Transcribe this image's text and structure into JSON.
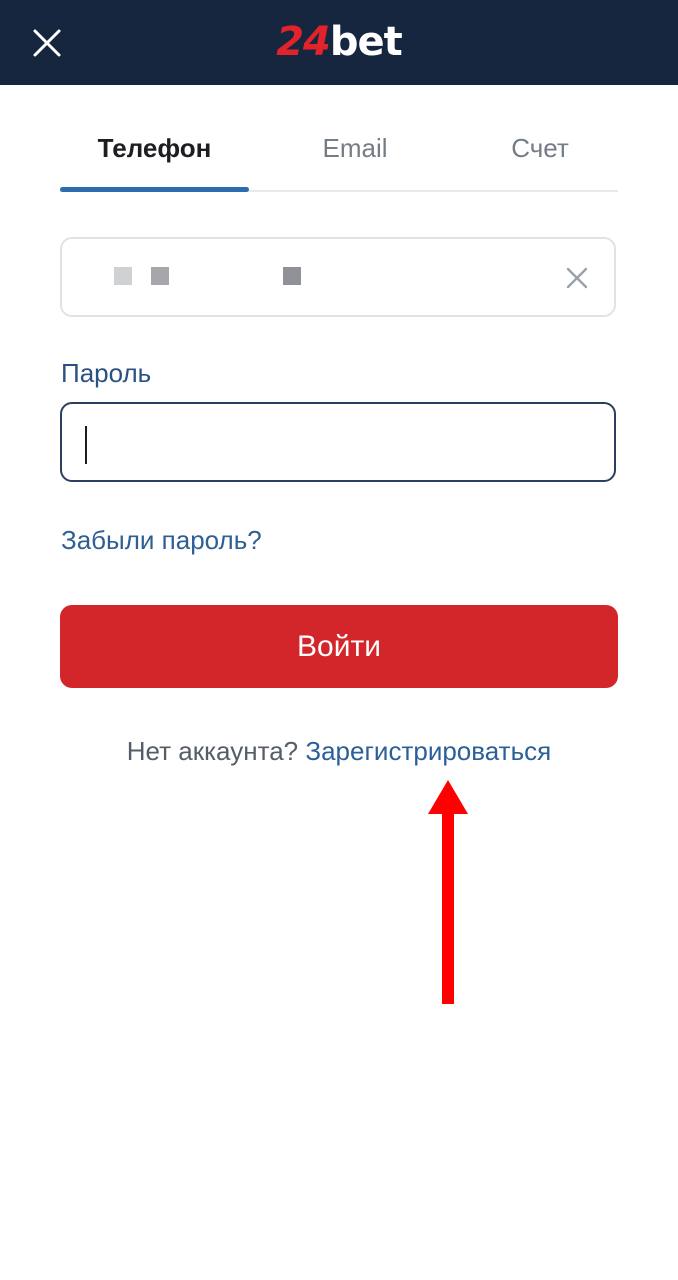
{
  "header": {
    "logo_number": "24",
    "logo_word": "bet",
    "close_icon": "close-icon"
  },
  "tabs": [
    {
      "label": "Телефон",
      "active": true
    },
    {
      "label": "Email",
      "active": false
    },
    {
      "label": "Счет",
      "active": false
    }
  ],
  "phone_input": {
    "value": "",
    "masked_squares": 3,
    "clear_icon": "clear-x-icon"
  },
  "password": {
    "label": "Пароль",
    "value": ""
  },
  "forgot_link": "Забыли пароль?",
  "login_button": "Войти",
  "signup": {
    "question": "Нет аккаунта?",
    "link": "Зарегистрироваться"
  },
  "colors": {
    "header_bg": "#17263f",
    "brand_red": "#d3262a",
    "accent_blue": "#2d6cb0",
    "annotation_arrow": "#ff0000"
  }
}
